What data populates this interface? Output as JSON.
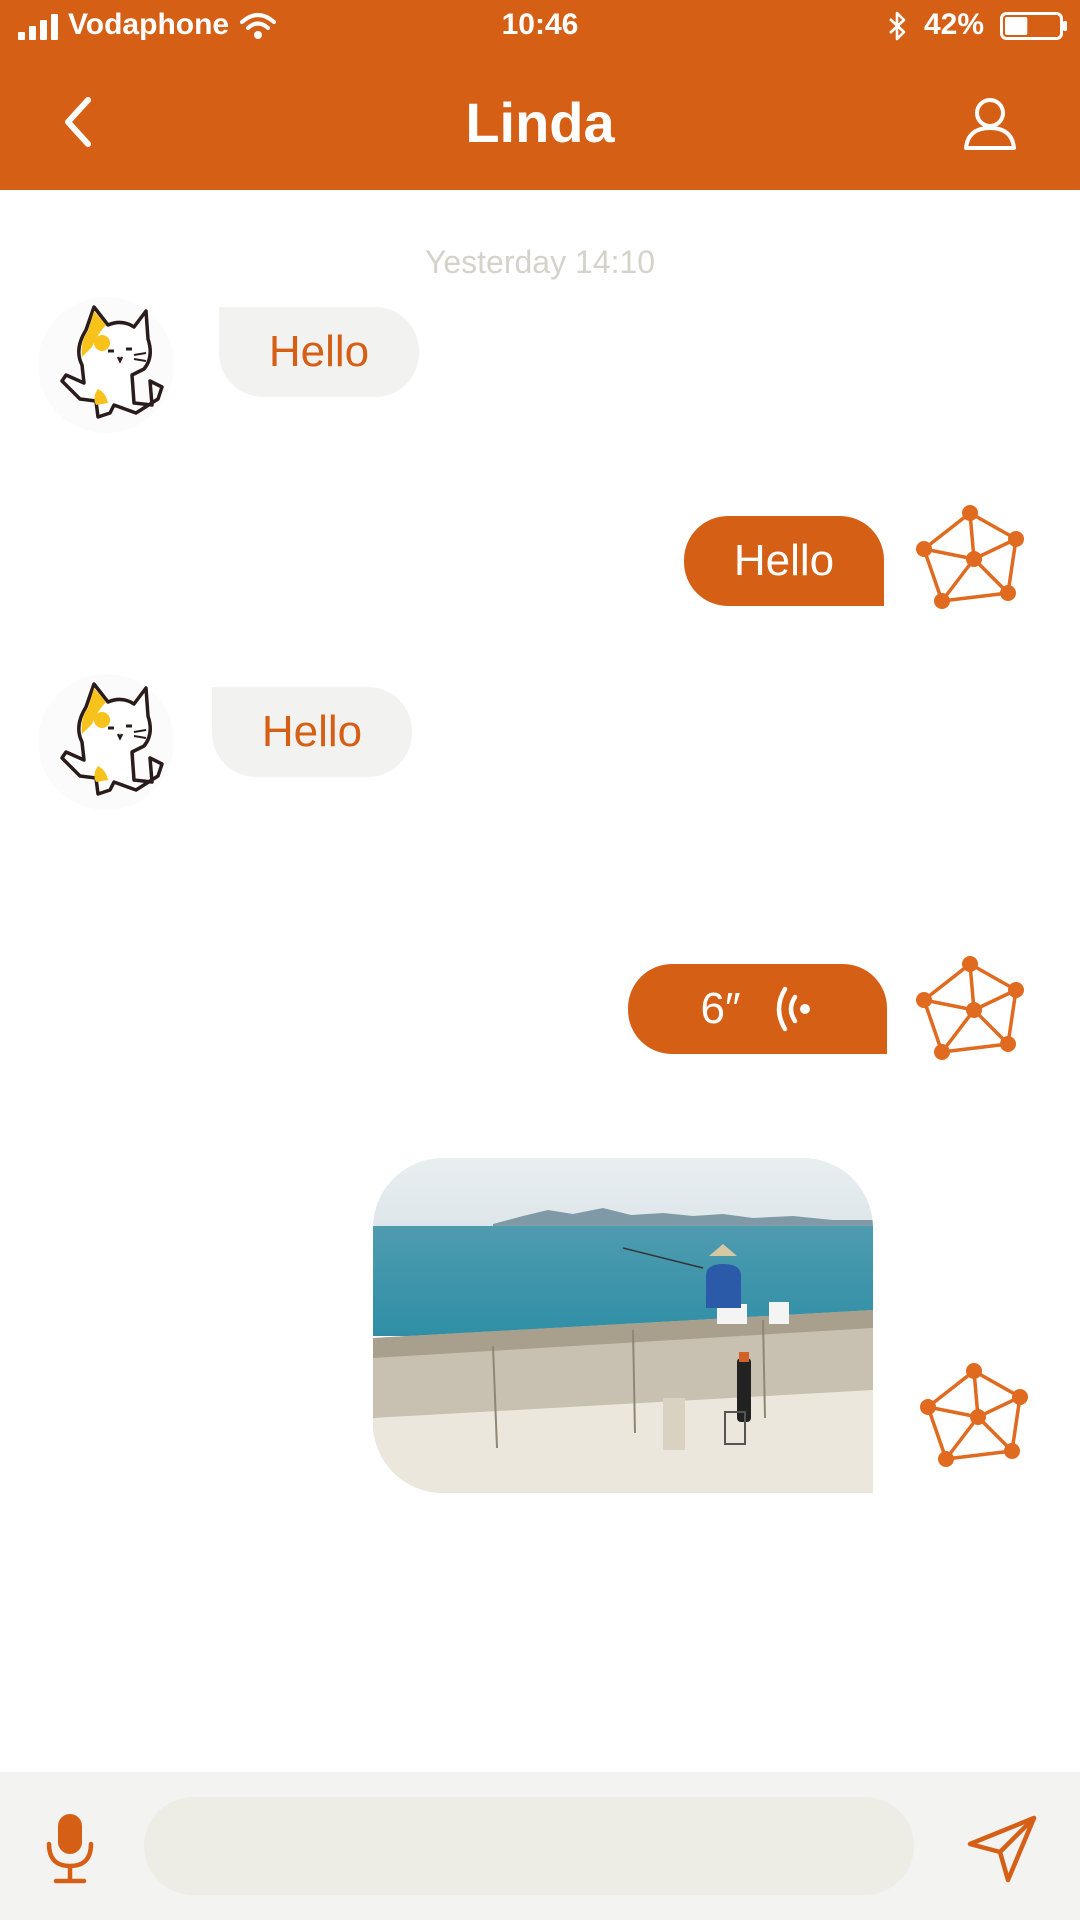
{
  "status_bar": {
    "carrier": "Vodaphone",
    "time": "10:46",
    "battery": "42%",
    "battery_level": 0.42
  },
  "header": {
    "title": "Linda",
    "back_icon": "chevron-left-icon",
    "profile_icon": "user-icon"
  },
  "conversation": {
    "timestamp": "Yesterday 14:10",
    "messages": [
      {
        "direction": "incoming",
        "type": "text",
        "text": "Hello",
        "avatar": "cat-avatar"
      },
      {
        "direction": "outgoing",
        "type": "text",
        "text": "Hello",
        "avatar": "network-avatar"
      },
      {
        "direction": "incoming",
        "type": "text",
        "text": "Hello",
        "avatar": "cat-avatar"
      },
      {
        "direction": "outgoing",
        "type": "voice",
        "duration": "6″",
        "avatar": "network-avatar"
      },
      {
        "direction": "outgoing",
        "type": "image",
        "avatar": "network-avatar"
      }
    ]
  },
  "composer": {
    "mic_icon": "microphone-icon",
    "input_value": "",
    "send_icon": "send-icon"
  },
  "colors": {
    "accent": "#d65f16",
    "incoming_bubble": "#f2f2f0",
    "input_background": "#eeede5",
    "bottom_bar": "#f3f3f1",
    "timestamp": "#d5d3c9"
  }
}
